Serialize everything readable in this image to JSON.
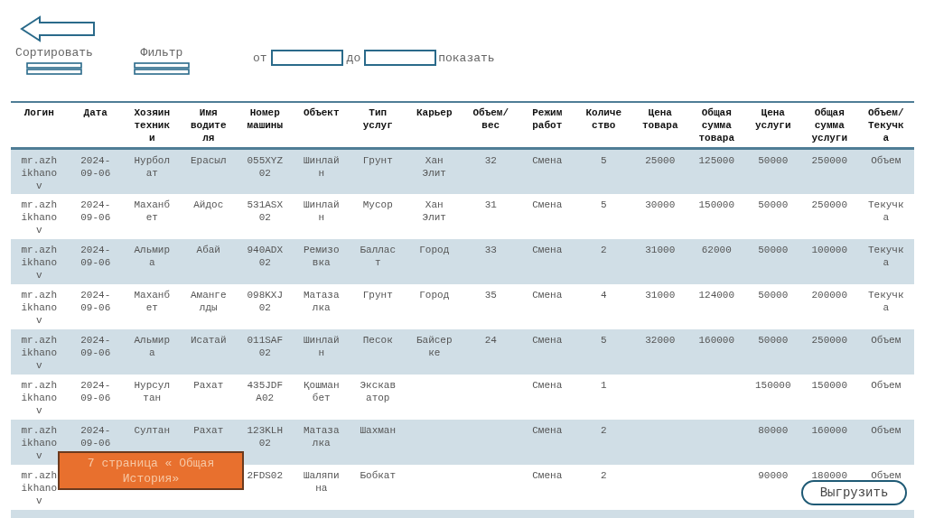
{
  "toolbar": {
    "sort": {
      "label": "Сортировать"
    },
    "filter": {
      "label": "Фильтр"
    },
    "date_range": {
      "from_label": "от",
      "to_label": "до",
      "show_label": "показать"
    }
  },
  "table": {
    "columns": [
      "Логин",
      "Дата",
      "Хозяин техники",
      "Имя водителя",
      "Номер машины",
      "Объект",
      "Тип услуг",
      "Карьер",
      "Объем/ вес",
      "Режим работ",
      "Количество",
      "Цена товара",
      "Общая сумма товара",
      "Цена услуги",
      "Общая сумма услуги",
      "Объем/ Текучка"
    ],
    "rows": [
      [
        "mr.azhikhanov",
        "2024-09-06",
        "Нурболат",
        "Ерасыл",
        "055XYZ02",
        "Шинлайн",
        "Грунт",
        "Хан Элит",
        "32",
        "Смена",
        "5",
        "25000",
        "125000",
        "50000",
        "250000",
        "Объем"
      ],
      [
        "mr.azhikhanov",
        "2024-09-06",
        "Маханбет",
        "Айдос",
        "531ASX02",
        "Шинлайн",
        "Мусор",
        "Хан Элит",
        "31",
        "Смена",
        "5",
        "30000",
        "150000",
        "50000",
        "250000",
        "Текучка"
      ],
      [
        "mr.azhikhanov",
        "2024-09-06",
        "Альмира",
        "Абай",
        "940ADX02",
        "Ремизовка",
        "Балласт",
        "Город",
        "33",
        "Смена",
        "2",
        "31000",
        "62000",
        "50000",
        "100000",
        "Текучка"
      ],
      [
        "mr.azhikhanov",
        "2024-09-06",
        "Маханбет",
        "Амангелды",
        "098KXJ02",
        "Матазалка",
        "Грунт",
        "Город",
        "35",
        "Смена",
        "4",
        "31000",
        "124000",
        "50000",
        "200000",
        "Текучка"
      ],
      [
        "mr.azhikhanov",
        "2024-09-06",
        "Альмира",
        "Исатай",
        "011SAF02",
        "Шинлайн",
        "Песок",
        "Байсерке",
        "24",
        "Смена",
        "5",
        "32000",
        "160000",
        "50000",
        "250000",
        "Объем"
      ],
      [
        "mr.azhikhanov",
        "2024-09-06",
        "Нурсултан",
        "Рахат",
        "435JDFA02",
        "Қошманбет",
        "Экскаватор",
        null,
        null,
        "Смена",
        "1",
        null,
        null,
        "150000",
        "150000",
        "Объем"
      ],
      [
        "mr.azhikhanov",
        "2024-09-06",
        "Султан",
        "Рахат",
        "123KLH02",
        "Матазалка",
        "Шахман",
        null,
        null,
        "Смена",
        "2",
        null,
        null,
        "80000",
        "160000",
        "Объем"
      ],
      [
        "mr.azhikhanov",
        null,
        null,
        null,
        "2FDS02",
        "Шаляпина",
        "Бобкат",
        null,
        null,
        "Смена",
        "2",
        null,
        null,
        "90000",
        "180000",
        "Объем"
      ]
    ]
  },
  "annotation": {
    "text": "7 страница « Общая История»"
  },
  "export_button": {
    "label": "Выгрузить"
  }
}
